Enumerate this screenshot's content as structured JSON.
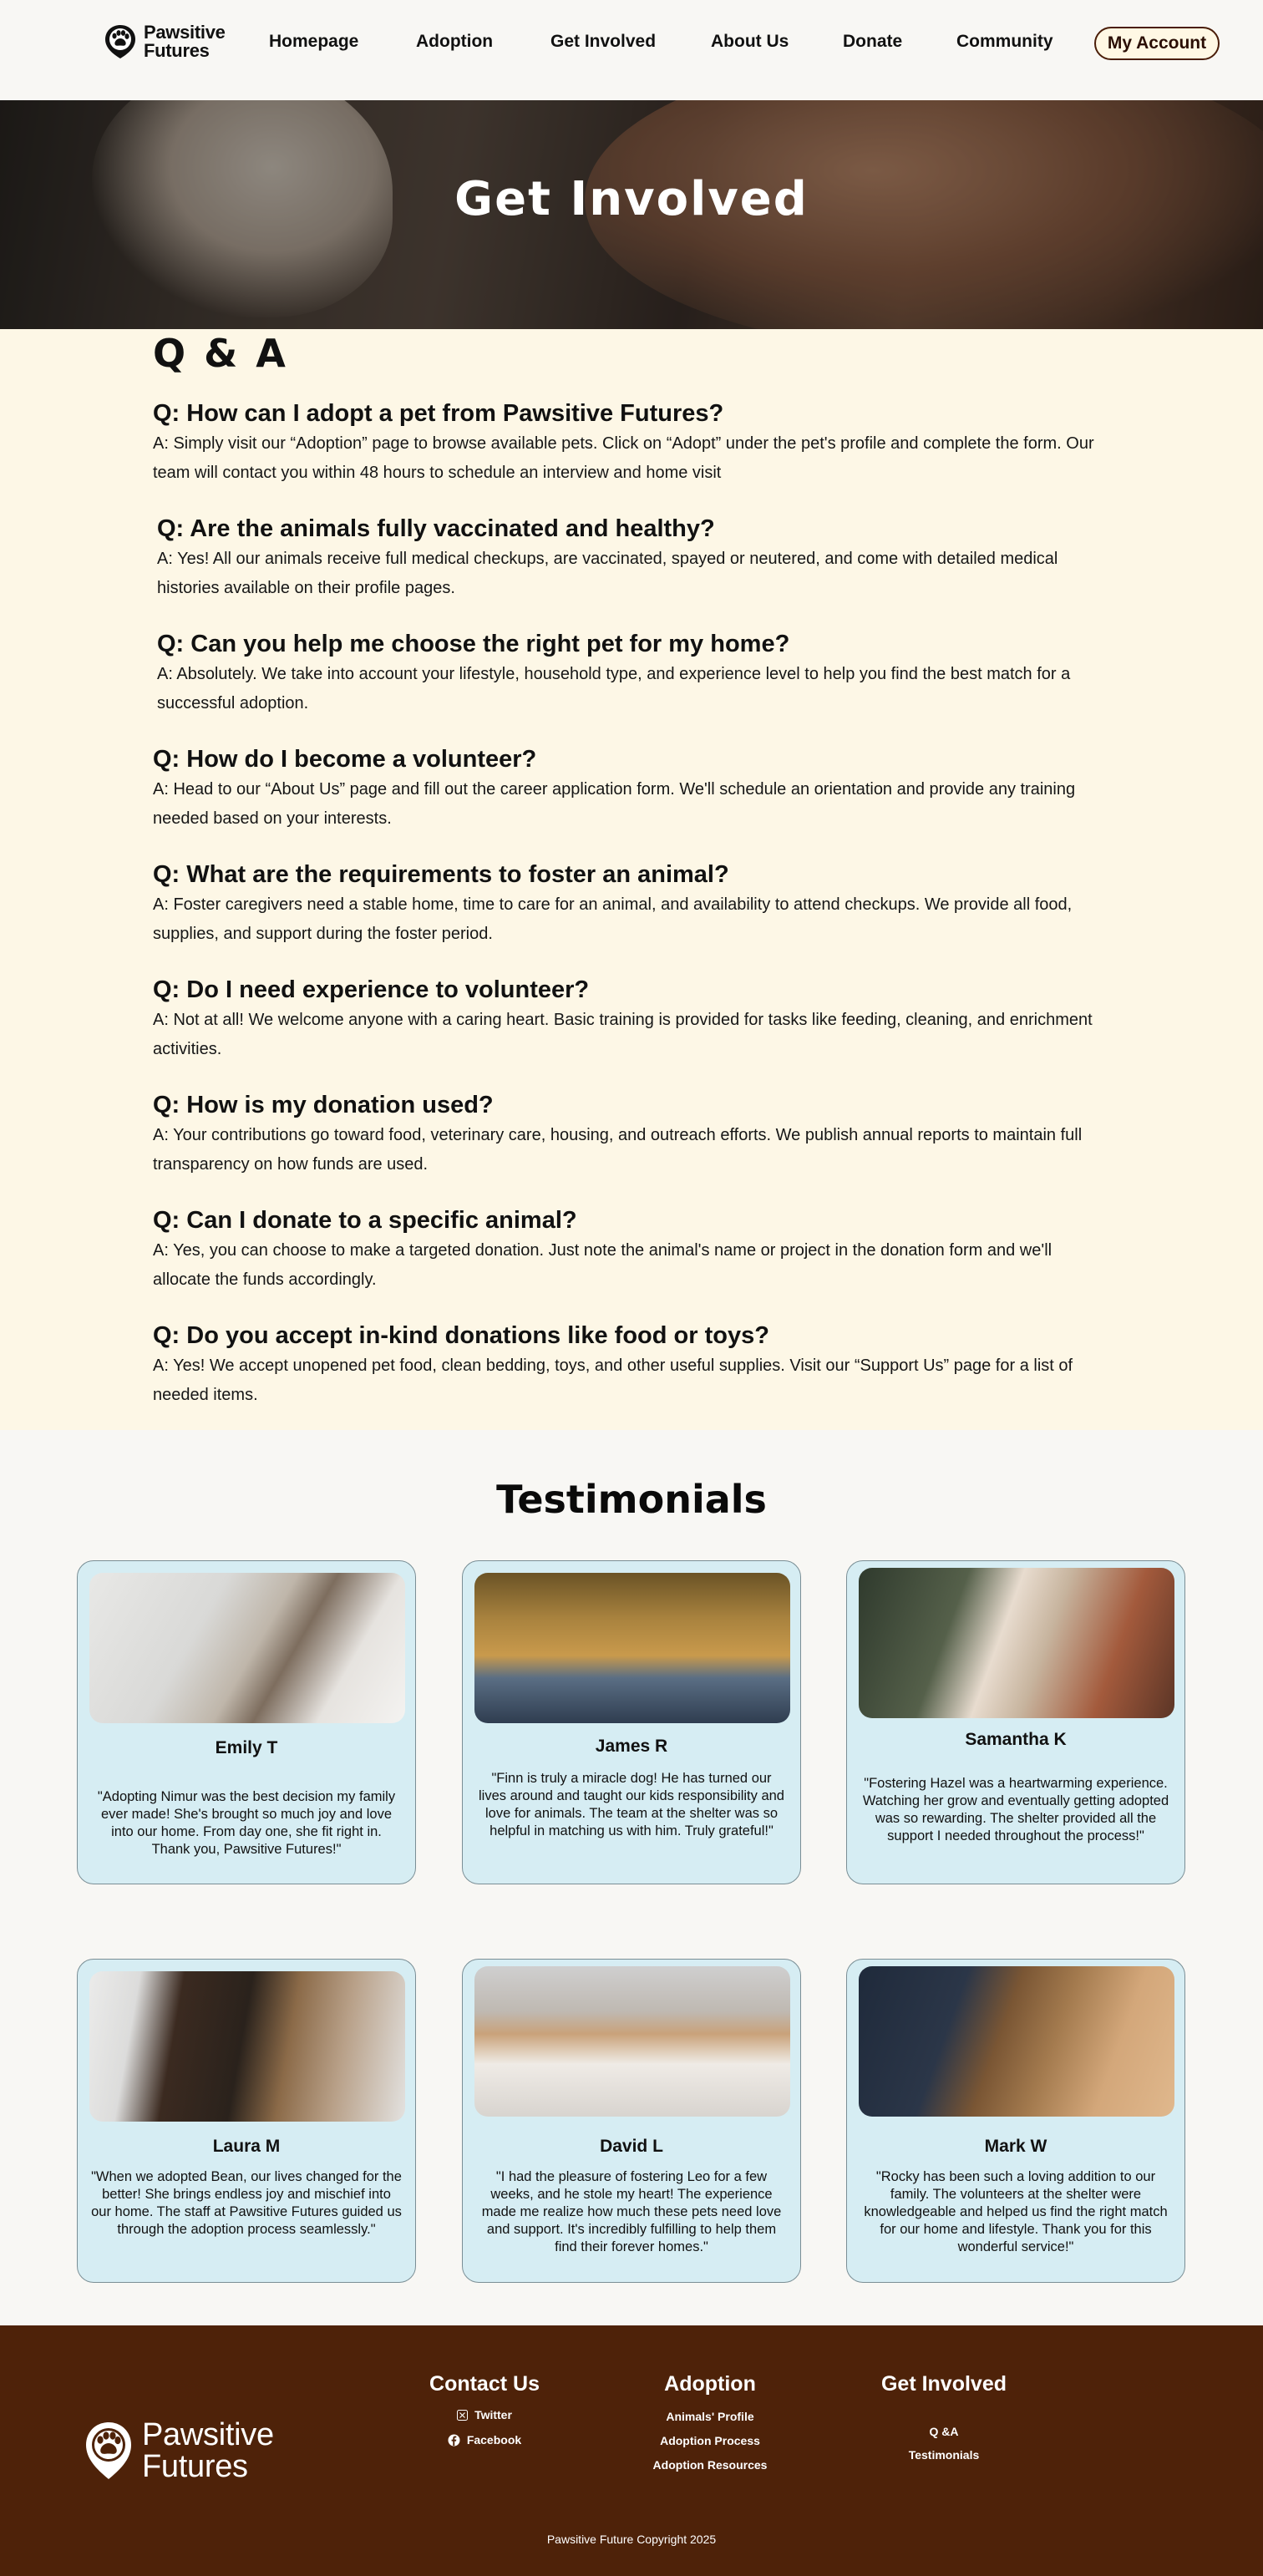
{
  "brand": {
    "name_line1": "Pawsitive",
    "name_line2": "Futures"
  },
  "nav": {
    "links": [
      "Homepage",
      "Adoption",
      "Get Involved",
      "About Us",
      "Donate",
      "Community"
    ],
    "account": "My Account"
  },
  "hero": {
    "title": "Get Involved"
  },
  "qa": {
    "title": "Q & A",
    "items": [
      {
        "q": "Q: How can I adopt a pet from Pawsitive Futures?",
        "a": "A: Simply visit our “Adoption” page to browse available pets. Click on “Adopt” under the pet's profile and complete the form. Our team will contact you within 48 hours to schedule an interview and home visit"
      },
      {
        "q": "Q: Are the animals fully vaccinated and healthy?",
        "a": "A: Yes! All our animals receive full medical checkups, are vaccinated, spayed or neutered, and come with detailed medical histories available on their profile pages."
      },
      {
        "q": "Q: Can you help me choose the right pet for my home?",
        "a": "A: Absolutely. We take into account your lifestyle, household type, and experience level to help you find the best match for a successful adoption."
      },
      {
        "q": "Q: How do I become a volunteer?",
        "a": "A: Head to our “About Us” page and fill out the career application form. We'll schedule an orientation and provide any training needed based on your interests."
      },
      {
        "q": "Q: What are the requirements to foster an animal?",
        "a": "A: Foster caregivers need a stable home, time to care for an animal, and availability to attend checkups. We provide all food, supplies, and support during the foster period."
      },
      {
        "q": "Q: Do I need experience to volunteer?",
        "a": "A: Not at all! We welcome anyone with a caring heart. Basic training is provided for tasks like feeding, cleaning, and enrichment activities."
      },
      {
        "q": "Q: How is my donation used?",
        "a": "A: Your contributions go toward food, veterinary care, housing, and outreach efforts. We publish annual reports to maintain full transparency on how funds are used."
      },
      {
        "q": "Q: Can I donate to a specific animal?",
        "a": "A: Yes, you can choose to make a targeted donation. Just note the animal's name or project in the donation form and we'll allocate the funds accordingly."
      },
      {
        "q": "Q: Do you accept in-kind donations like food or toys?",
        "a": "A: Yes! We accept unopened pet food, clean bedding, toys, and other useful supplies. Visit our “Support Us” page for a list of needed items."
      }
    ]
  },
  "testimonials": {
    "title": "Testimonials",
    "items": [
      {
        "name": "Emily T",
        "quote": "\"Adopting Nimur was the best decision my family ever made! She's brought so much joy and love into our home. From day one, she fit right in. Thank you, Pawsitive Futures!\""
      },
      {
        "name": "James R",
        "quote": "\"Finn is truly a miracle dog! He has turned our lives around and taught our kids responsibility and love for animals. The team at the shelter was so helpful in matching us with him. Truly grateful!\""
      },
      {
        "name": "Samantha K",
        "quote": "\"Fostering Hazel was a heartwarming experience. Watching her grow and eventually getting adopted was so rewarding. The shelter provided all the support I needed throughout the process!\""
      },
      {
        "name": "Laura M",
        "quote": "\"When we adopted Bean, our lives changed for the better! She brings endless joy and mischief into our home. The staff at Pawsitive Futures guided us through the adoption process seamlessly.\""
      },
      {
        "name": "David L",
        "quote": "\"I had the pleasure of fostering Leo for a few weeks, and he stole my heart! The experience made me realize how much these pets need love and support. It's incredibly fulfilling to help them find their forever homes.\""
      },
      {
        "name": "Mark W",
        "quote": "\"Rocky has been such a loving addition to our family. The volunteers at the shelter were knowledgeable and helped us find the right match for our home and lifestyle. Thank you for this wonderful service!\""
      }
    ]
  },
  "footer": {
    "contact": {
      "title": "Contact Us",
      "links": [
        "Twitter",
        "Facebook"
      ]
    },
    "adoption": {
      "title": "Adoption",
      "links": [
        "Animals' Profile",
        "Adoption Process",
        "Adoption Resources"
      ]
    },
    "involved": {
      "title": "Get Involved",
      "links": [
        "Q &A",
        "Testimonials"
      ]
    },
    "copyright": "Pawsitive Future Copyright 2025"
  },
  "colors": {
    "accent_brown": "#4e2209",
    "qa_bg": "#fdf7e6",
    "card_bg": "#d6edf3"
  }
}
